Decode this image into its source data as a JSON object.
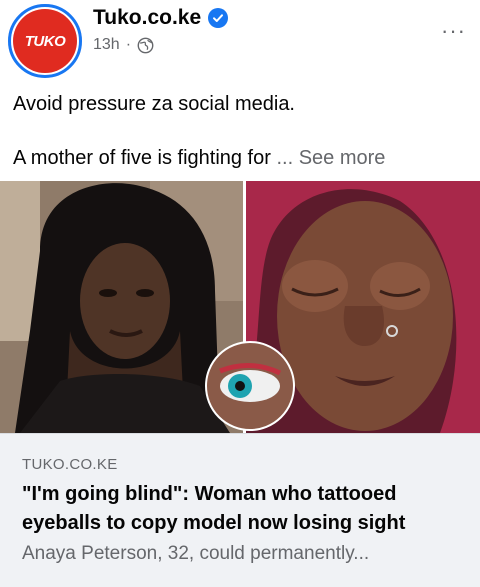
{
  "post": {
    "page_name": "Tuko.co.ke",
    "logo_text": "TUKO",
    "timestamp": "13h",
    "separator": "·",
    "privacy_icon": "globe-icon",
    "verified_icon": "verified-badge-icon",
    "more_icon": "more-options-icon",
    "more_label": "···",
    "caption_line1": "Avoid pressure za social media.",
    "caption_line2": "A mother of five is fighting for ",
    "ellipsis": "...",
    "see_more": "See more"
  },
  "link_card": {
    "domain": "TUKO.CO.KE",
    "headline": "\"I'm going blind\": Woman who tattooed eyeballs to copy model now losing sight",
    "summary": "Anaya Peterson, 32, could permanently..."
  },
  "colors": {
    "brand_red": "#e02b20",
    "facebook_blue": "#1877f2",
    "secondary_text": "#65676b",
    "card_background": "#f0f2f5"
  }
}
